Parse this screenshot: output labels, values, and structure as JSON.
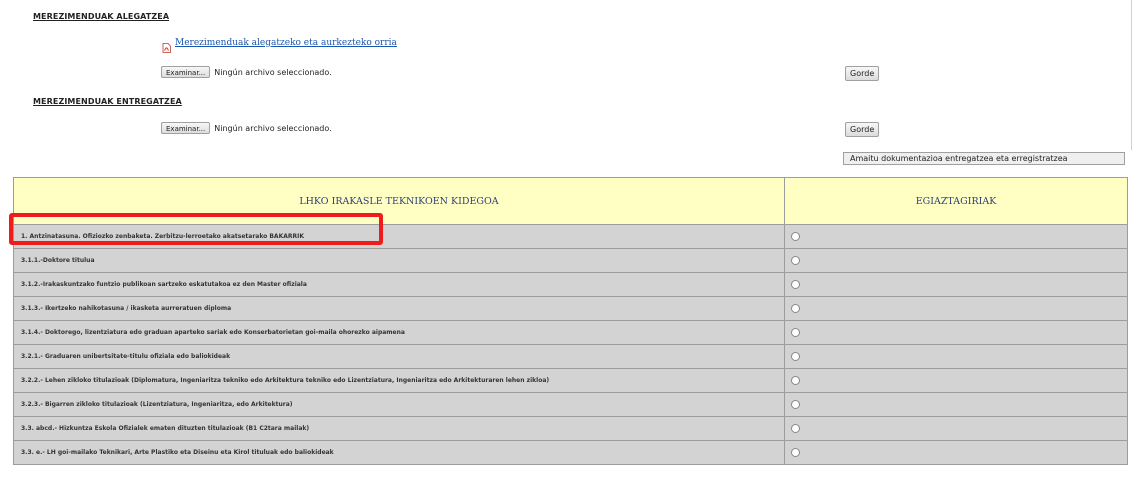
{
  "section1": {
    "heading": "MEREZIMENDUAK ALEGATZEA",
    "pdf_link": "Merezimenduak alegatzeko eta aurkezteko orria",
    "browse_label": "Examinar...",
    "file_status": "Ningún archivo seleccionado.",
    "save_label": "Gorde"
  },
  "section2": {
    "heading": "MEREZIMENDUAK ENTREGATZEA",
    "browse_label": "Examinar...",
    "file_status": "Ningún archivo seleccionado.",
    "save_label": "Gorde"
  },
  "finish_button": "Amaitu dokumentazioa entregatzea eta erregistratzea",
  "table": {
    "col1_header": "LHKO IRAKASLE TEKNIKOEN KIDEGOA",
    "col2_header": "EGIAZTAGIRIAK",
    "rows": [
      "1. Antzinatasuna. Ofiziozko zenbaketa. Zerbitzu-lerroetako akatsetarako BAKARRIK",
      "3.1.1.-Doktore titulua",
      "3.1.2.-Irakaskuntzako funtzio publikoan sartzeko eskatutakoa ez den Master ofiziala",
      "3.1.3.- Ikertzeko nahikotasuna / ikasketa aurreratuen diploma",
      "3.1.4.- Doktorego, lizentziatura edo graduan aparteko sariak edo Konserbatorietan goi-maila ohorezko aipamena",
      "3.2.1.- Graduaren unibertsitate-titulu ofiziala edo baliokideak",
      "3.2.2.- Lehen zikloko titulazioak (Diplomatura, Ingeniaritza tekniko edo Arkitektura tekniko edo Lizentziatura, Ingeniaritza edo Arkitekturaren lehen zikloa)",
      "3.2.3.- Bigarren zikloko titulazioak (Lizentziatura, Ingeniaritza, edo Arkitektura)",
      "3.3. abcd.- Hizkuntza Eskola Ofizialek ematen dituzten titulazioak (B1 C2tara mailak)",
      "3.3. e.- LH goi-mailako Teknikari, Arte Plastiko eta Diseinu eta Kirol tituluak edo baliokideak"
    ]
  },
  "colors": {
    "header_bg": "#ffffc4",
    "row_bg": "#d3d3d3",
    "highlight": "#ee1c1c",
    "link": "#1a56b0"
  },
  "icons": {
    "pdf": "pdf-file-icon",
    "radio": "radio-button"
  }
}
